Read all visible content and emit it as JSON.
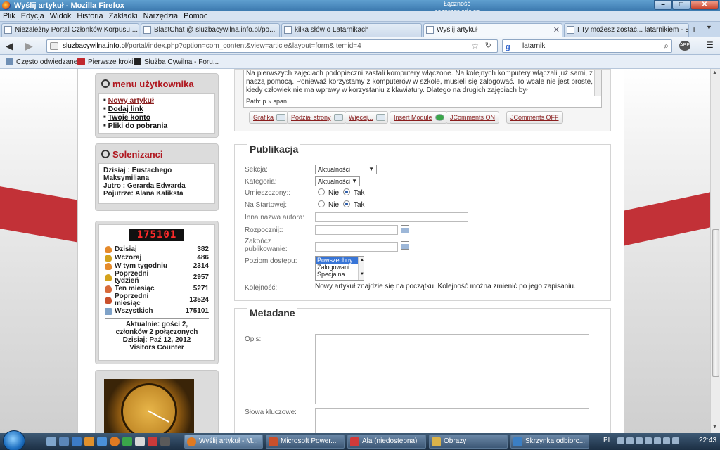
{
  "window": {
    "title": "Wyślij artykuł - Mozilla Firefox",
    "network_status": "Łączność bezprzewodowa",
    "controls": {
      "minimize": "–",
      "maximize": "□",
      "close": "✕"
    }
  },
  "menu": [
    "Plik",
    "Edycja",
    "Widok",
    "Historia",
    "Zakładki",
    "Narzędzia",
    "Pomoc"
  ],
  "tabs": [
    {
      "label": "Niezależny Portal Członków Korpusu ...",
      "active": false
    },
    {
      "label": "BlastChat @ sluzbacywilna.info.pl/po...",
      "active": false
    },
    {
      "label": "kilka słów o Latarnikach",
      "active": false
    },
    {
      "label": "Wyślij artykuł",
      "active": true
    },
    {
      "label": "I Ty możesz zostać... latarnikiem - Bis...",
      "active": false
    }
  ],
  "nav": {
    "url_domain": "sluzbacywilna.info.pl",
    "url_path": "/portal/index.php?option=com_content&view=article&layout=form&Itemid=4",
    "search_engine": "g",
    "search_value": "latarnik",
    "addon_badge": "ABP"
  },
  "bookmarks": [
    {
      "label": "Często odwiedzane",
      "color": "#6f8fb5"
    },
    {
      "label": "Pierwsze kroki",
      "color": "#c0272d"
    },
    {
      "label": "Służba Cywilna - Foru...",
      "color": "#222222"
    }
  ],
  "sidebar": {
    "user_menu": {
      "title": "menu użytkownika",
      "items": [
        "Nowy artykuł",
        "Dodaj link",
        "Twoje konto",
        "Pliki do pobrania"
      ]
    },
    "names_day": {
      "title": "Solenizanci",
      "today": "Dzisiaj : Eustachego Maksymiliana",
      "tomorrow": "Jutro : Gerarda Edwarda",
      "day_after": "Pojutrze: Alana Kaliksta"
    },
    "counter": {
      "digits": "175101",
      "rows": [
        {
          "label": "Dzisiaj",
          "value": "382",
          "color": "#e58a2b"
        },
        {
          "label": "Wczoraj",
          "value": "486",
          "color": "#d4a21c"
        },
        {
          "label": "W tym tygodniu",
          "value": "2314",
          "color": "#e58a2b"
        },
        {
          "label": "Poprzedni tydzień",
          "value": "2957",
          "color": "#d4a21c"
        },
        {
          "label": "Ten miesiąc",
          "value": "5271",
          "color": "#d86a3a"
        },
        {
          "label": "Poprzedni miesiąc",
          "value": "13524",
          "color": "#c9502c"
        },
        {
          "label": "Wszystkich",
          "value": "175101",
          "color": "#7fa2c8"
        }
      ],
      "summary_line1": "Aktualnie: gości 2,",
      "summary_line2": "członków 2 połączonych",
      "summary_line3": "Dzisiaj: Paź 12, 2012",
      "summary_line4": "Visitors Counter"
    }
  },
  "editor": {
    "text": "Na pierwszych zajęciach podopieczni zastali komputery włączone. Na kolejnych komputery włączali już sami, z naszą pomocą. Ponieważ korzystamy z komputerów w szkole, musieli się zalogować. To wcale nie jest proste, kiedy człowiek nie ma wprawy w korzystaniu z klawiatury. Dlatego na drugich zajęciach był",
    "path": "Path: p » span",
    "buttons": [
      "Grafika",
      "Podział strony",
      "Więcej...",
      "Insert Module",
      "JComments ON",
      "JComments OFF"
    ]
  },
  "publikacja": {
    "legend": "Publikacja",
    "section_label": "Sekcja:",
    "section_value": "Aktualności",
    "category_label": "Kategoria:",
    "category_value": "Aktualności",
    "published_label": "Umieszczony::",
    "frontpage_label": "Na Startowej:",
    "no_label": "Nie",
    "yes_label": "Tak",
    "author_alias_label": "Inna nazwa autora:",
    "start_label": "Rozpocznij::",
    "finish_label": "Zakończ publikowanie:",
    "access_label": "Poziom dostępu:",
    "access_options": [
      "Powszechny",
      "Zalogowani",
      "Specjalna"
    ],
    "order_label": "Kolejność:",
    "order_text": "Nowy artykuł znajdzie się na początku. Kolejność można zmienić po jego zapisaniu."
  },
  "metadane": {
    "legend": "Metadane",
    "description_label": "Opis:",
    "keywords_label": "Słowa kluczowe:"
  },
  "taskbar": {
    "tasks": [
      {
        "label": "Wyślij artykuł - M...",
        "color": "#e07a22",
        "active": true
      },
      {
        "label": "Microsoft Power...",
        "color": "#c9502c",
        "active": false
      },
      {
        "label": "Ala (niedostępna)",
        "color": "#d23a3a",
        "active": false
      },
      {
        "label": "Obrazy",
        "color": "#d9b24a",
        "active": false
      },
      {
        "label": "Skrzynka odbiorc...",
        "color": "#3b7fc4",
        "active": false
      }
    ],
    "language": "PL",
    "time": "22:43"
  }
}
